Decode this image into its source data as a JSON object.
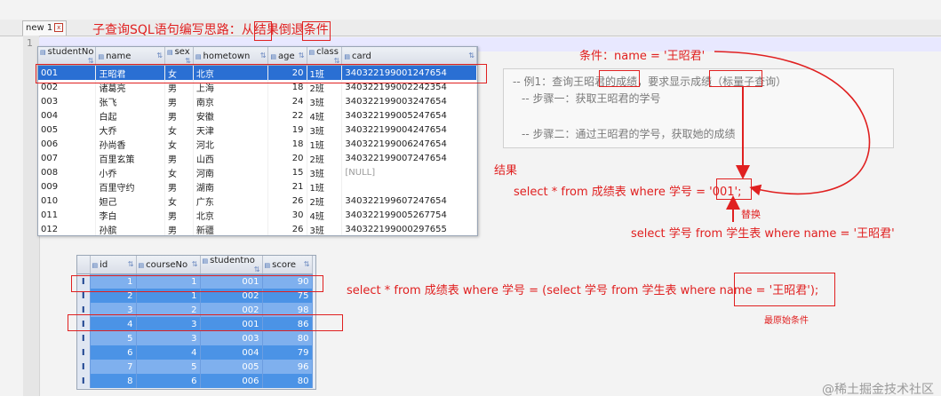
{
  "editor": {
    "tab_label": "new 1",
    "tab_close_glyph": "x",
    "line_number": "1"
  },
  "title": "子查询SQL语句编写思路：从结果倒退条件",
  "student_grid": {
    "columns": [
      "studentNo",
      "name",
      "sex",
      "hometown",
      "age",
      "class",
      "card"
    ],
    "rows": [
      [
        "001",
        "王昭君",
        "女",
        "北京",
        "20",
        "1班",
        "340322199001247654"
      ],
      [
        "002",
        "诸葛亮",
        "男",
        "上海",
        "18",
        "2班",
        "340322199002242354"
      ],
      [
        "003",
        "张飞",
        "男",
        "南京",
        "24",
        "3班",
        "340322199003247654"
      ],
      [
        "004",
        "白起",
        "男",
        "安徽",
        "22",
        "4班",
        "340322199005247654"
      ],
      [
        "005",
        "大乔",
        "女",
        "天津",
        "19",
        "3班",
        "340322199004247654"
      ],
      [
        "006",
        "孙尚香",
        "女",
        "河北",
        "18",
        "1班",
        "340322199006247654"
      ],
      [
        "007",
        "百里玄策",
        "男",
        "山西",
        "20",
        "2班",
        "340322199007247654"
      ],
      [
        "008",
        "小乔",
        "女",
        "河南",
        "15",
        "3班",
        "[NULL]"
      ],
      [
        "009",
        "百里守约",
        "男",
        "湖南",
        "21",
        "1班",
        ""
      ],
      [
        "010",
        "妲己",
        "女",
        "广东",
        "26",
        "2班",
        "340322199607247654"
      ],
      [
        "011",
        "李白",
        "男",
        "北京",
        "30",
        "4班",
        "340322199005267754"
      ],
      [
        "012",
        "孙膑",
        "男",
        "新疆",
        "26",
        "3班",
        "340322199000297655"
      ]
    ]
  },
  "score_grid": {
    "columns": [
      "id",
      "courseNo",
      "studentno",
      "score"
    ],
    "rows": [
      [
        "1",
        "1",
        "001",
        "90"
      ],
      [
        "2",
        "1",
        "002",
        "75"
      ],
      [
        "3",
        "2",
        "002",
        "98"
      ],
      [
        "4",
        "3",
        "001",
        "86"
      ],
      [
        "5",
        "3",
        "003",
        "80"
      ],
      [
        "6",
        "4",
        "004",
        "79"
      ],
      [
        "7",
        "5",
        "005",
        "96"
      ],
      [
        "8",
        "6",
        "006",
        "80"
      ]
    ]
  },
  "sql_comments": [
    "-- 例1：查询王昭君的成绩，要求显示成绩（标量子查询）",
    "-- 步骤一：获取王昭君的学号",
    "-- 步骤二：通过王昭君的学号，获取她的成绩"
  ],
  "annotations": {
    "condition": "条件：name = '王昭君'",
    "result_label": "结果",
    "query_result": "select * from 成绩表 where 学号 = '001';",
    "replace_label": "替换",
    "query_sub": "select 学号 from  学生表 where name = '王昭君'",
    "query_full": "select * from 成绩表 where 学号 = (select 学号 from  学生表 where name = '王昭君');",
    "original_condition": "最原始条件"
  },
  "watermark": "@稀土掘金技术社区",
  "colors": {
    "annotation_red": "#e02020",
    "selection_blue": "#2a6fd3",
    "score_row_dark": "#4b93e6",
    "score_row_light": "#7fb0ee"
  }
}
